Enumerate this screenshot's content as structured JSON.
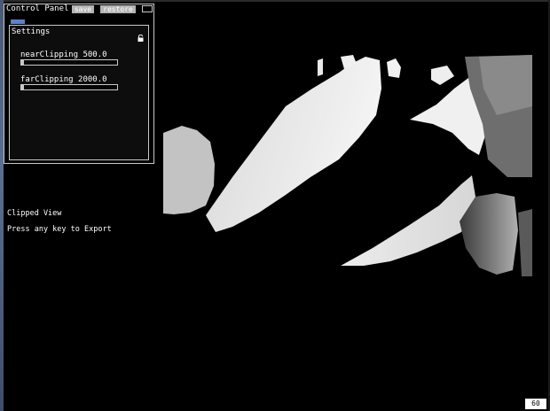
{
  "control_panel": {
    "title": "Control Panel",
    "save_label": "save",
    "restore_label": "restore",
    "group": {
      "label": "Settings",
      "sliders": [
        {
          "label": "nearClipping 500.0",
          "fraction": 0.0
        },
        {
          "label": "farClipping 2000.0",
          "fraction": 0.03
        }
      ]
    }
  },
  "overlay": {
    "status": "Clipped View",
    "hint": "Press any key to Export"
  },
  "fps": "60",
  "colors": {
    "background": "#000000",
    "panel_border": "#c8c8c8",
    "button": "#b4b4b4",
    "tab_accent": "#5f80c8"
  }
}
